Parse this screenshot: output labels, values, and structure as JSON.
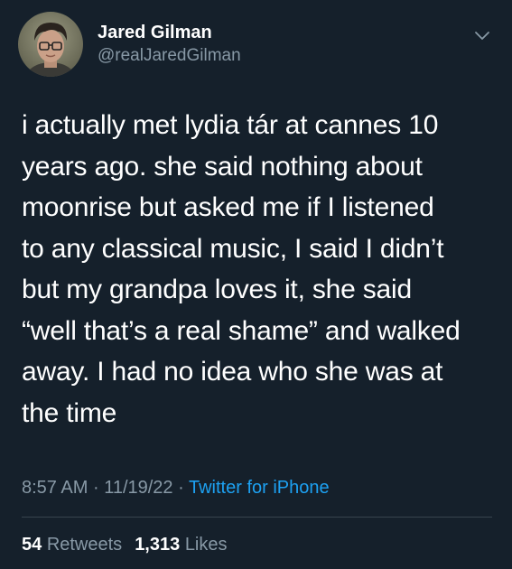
{
  "colors": {
    "background": "#15202b",
    "primary_text": "#ffffff",
    "secondary_text": "#8899a6",
    "link": "#1da1f2",
    "divider": "#38444d"
  },
  "author": {
    "display_name": "Jared Gilman",
    "handle": "@realJaredGilman",
    "avatar_icon": "profile-photo",
    "more_icon": "chevron-down-icon"
  },
  "tweet": {
    "text": "i actually met lydia tár at cannes 10\nyears ago. she said nothing about\nmoonrise but asked me if I listened\nto any classical music, I said I didn’t\nbut my grandpa loves it, she said\n“well that’s a real shame” and walked\naway. I had no idea who she was at\nthe time",
    "time": "8:57 AM",
    "date": "11/19/22",
    "separator": "·",
    "source": "Twitter for iPhone"
  },
  "stats": {
    "retweets_count": "54",
    "retweets_label": "Retweets",
    "likes_count": "1,313",
    "likes_label": "Likes"
  }
}
